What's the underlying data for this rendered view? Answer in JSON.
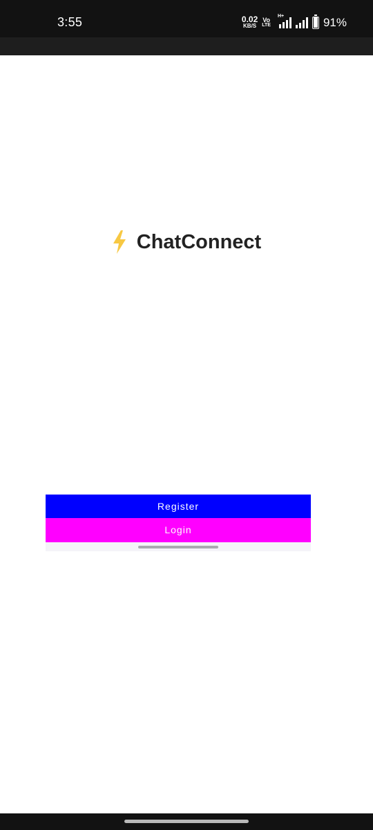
{
  "status_bar": {
    "time": "3:55",
    "net_speed_value": "0.02",
    "net_speed_unit": "KB/S",
    "volte_top": "Vo",
    "volte_bottom": "LTE",
    "signal_tag": "H+",
    "battery_percent": "91%",
    "battery_level": 0.91
  },
  "app": {
    "title": "ChatConnect",
    "title_icon": "lightning-bolt-icon",
    "bolt_color": "#F7C843"
  },
  "actions": {
    "register_label": "Register",
    "login_label": "Login",
    "register_color": "#0000FF",
    "login_color": "#FF00FF"
  }
}
